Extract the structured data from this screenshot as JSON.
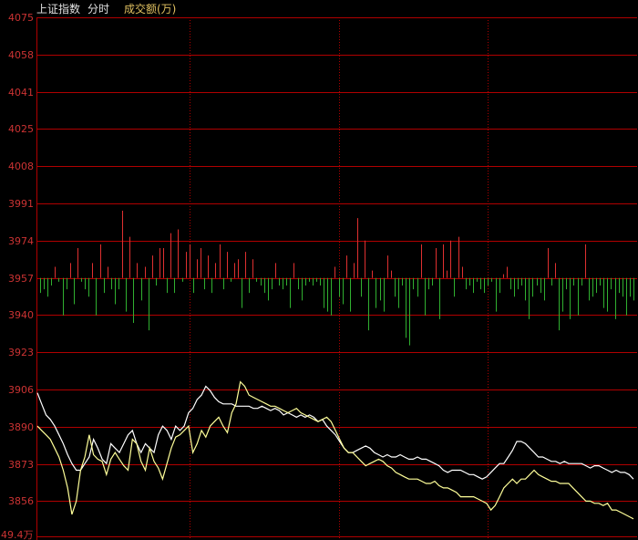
{
  "header": {
    "index_name": "上证指数",
    "mode": "分时",
    "indicator": "成交额(万)"
  },
  "colors": {
    "background": "#000000",
    "grid": "#b00000",
    "axis_label": "#cc3333",
    "header_text": "#e0e0e0",
    "indicator_text": "#e0c060",
    "bar_up": "#e03030",
    "bar_down": "#30b030",
    "line_price": "#ffffff",
    "line_avg": "#ffff99"
  },
  "chart_data": {
    "type": "line",
    "y_axis": {
      "ticks": [
        "4075",
        "4058",
        "4041",
        "4025",
        "4008",
        "3991",
        "3974",
        "3957",
        "3940",
        "3923",
        "3906",
        "3890",
        "3873",
        "3856"
      ],
      "baseline": 3957,
      "ylim": [
        3847,
        4075
      ],
      "bottom_label": "49.4万"
    },
    "bars": [
      -4,
      -3,
      -5,
      -2,
      3,
      -1,
      -10,
      -3,
      4,
      -7,
      8,
      -1,
      -3,
      -5,
      4,
      -10,
      9,
      -4,
      3,
      -3,
      -7,
      -3,
      18,
      -9,
      11,
      -12,
      4,
      -6,
      3,
      -14,
      6,
      -2,
      8,
      8,
      -4,
      12,
      -4,
      13,
      -1,
      7,
      9,
      -4,
      5,
      8,
      -3,
      6,
      -4,
      4,
      9,
      -3,
      7,
      -1,
      4,
      5,
      -8,
      7,
      -4,
      5,
      -1,
      -2,
      -4,
      -6,
      -3,
      4,
      -2,
      -3,
      -2,
      -8,
      4,
      -3,
      -6,
      -2,
      -1,
      -2,
      -1,
      -2,
      -8,
      -9,
      -10,
      3,
      -5,
      -7,
      6,
      -9,
      4,
      16,
      -5,
      10,
      -14,
      2,
      -8,
      -6,
      -9,
      6,
      2,
      -5,
      -8,
      -2,
      -16,
      -18,
      -3,
      -5,
      9,
      -10,
      -3,
      -2,
      8,
      -11,
      9,
      2,
      10,
      -5,
      11,
      3,
      -3,
      -2,
      -4,
      -1,
      -3,
      -4,
      -2,
      -1,
      -9,
      -4,
      1,
      3,
      -3,
      -5,
      -3,
      -2,
      -6,
      -11,
      -5,
      -2,
      -4,
      -6,
      8,
      -2,
      4,
      -14,
      -9,
      -3,
      -11,
      -2,
      -10,
      -2,
      9,
      -6,
      -5,
      -4,
      -2,
      -8,
      -9,
      -3,
      -11,
      -4,
      -5,
      -10,
      -5,
      -6
    ],
    "series": [
      {
        "values": [
          3905,
          3900,
          3895,
          3893,
          3890,
          3886,
          3882,
          3877,
          3873,
          3870,
          3870,
          3873,
          3876,
          3884,
          3880,
          3875,
          3873,
          3882,
          3880,
          3878,
          3882,
          3886,
          3888,
          3882,
          3878,
          3882,
          3880,
          3878,
          3886,
          3890,
          3888,
          3884,
          3890,
          3888,
          3890,
          3896,
          3898,
          3902,
          3904,
          3908,
          3906,
          3903,
          3901,
          3900,
          3900,
          3900,
          3899,
          3899,
          3899,
          3899,
          3898,
          3898,
          3899,
          3898,
          3897,
          3898,
          3897,
          3895,
          3896,
          3895,
          3894,
          3895,
          3894,
          3895,
          3894,
          3892,
          3893,
          3890,
          3888,
          3886,
          3883,
          3880,
          3878,
          3878,
          3879,
          3880,
          3881,
          3880,
          3878,
          3877,
          3876,
          3877,
          3876,
          3876,
          3877,
          3876,
          3875,
          3875,
          3876,
          3875,
          3875,
          3874,
          3873,
          3872,
          3870,
          3869,
          3870,
          3870,
          3870,
          3869,
          3868,
          3868,
          3867,
          3866,
          3867,
          3869,
          3871,
          3873,
          3873,
          3876,
          3879,
          3883,
          3883,
          3882,
          3880,
          3878,
          3876,
          3876,
          3875,
          3874,
          3874,
          3873,
          3874,
          3873,
          3873,
          3873,
          3873,
          3872,
          3871,
          3872,
          3872,
          3871,
          3870,
          3869,
          3870,
          3869,
          3869,
          3868,
          3866
        ]
      },
      {
        "values": [
          3890,
          3888,
          3886,
          3884,
          3880,
          3876,
          3870,
          3862,
          3850,
          3856,
          3870,
          3876,
          3886,
          3877,
          3875,
          3874,
          3868,
          3875,
          3878,
          3875,
          3872,
          3870,
          3884,
          3882,
          3874,
          3870,
          3880,
          3874,
          3871,
          3866,
          3873,
          3880,
          3885,
          3886,
          3888,
          3890,
          3878,
          3882,
          3888,
          3885,
          3890,
          3892,
          3894,
          3890,
          3887,
          3896,
          3900,
          3910,
          3908,
          3904,
          3903,
          3902,
          3901,
          3900,
          3899,
          3899,
          3898,
          3897,
          3896,
          3897,
          3898,
          3896,
          3895,
          3894,
          3893,
          3892,
          3893,
          3894,
          3892,
          3888,
          3884,
          3880,
          3878,
          3878,
          3876,
          3874,
          3872,
          3873,
          3874,
          3875,
          3874,
          3872,
          3871,
          3869,
          3868,
          3867,
          3866,
          3866,
          3866,
          3865,
          3864,
          3864,
          3865,
          3863,
          3862,
          3862,
          3861,
          3860,
          3858,
          3858,
          3858,
          3858,
          3857,
          3856,
          3855,
          3852,
          3854,
          3858,
          3862,
          3864,
          3866,
          3864,
          3866,
          3866,
          3868,
          3870,
          3868,
          3867,
          3866,
          3865,
          3865,
          3864,
          3864,
          3864,
          3862,
          3860,
          3858,
          3856,
          3856,
          3855,
          3855,
          3854,
          3855,
          3852,
          3852,
          3851,
          3850,
          3849,
          3848
        ]
      }
    ],
    "grid": true
  }
}
